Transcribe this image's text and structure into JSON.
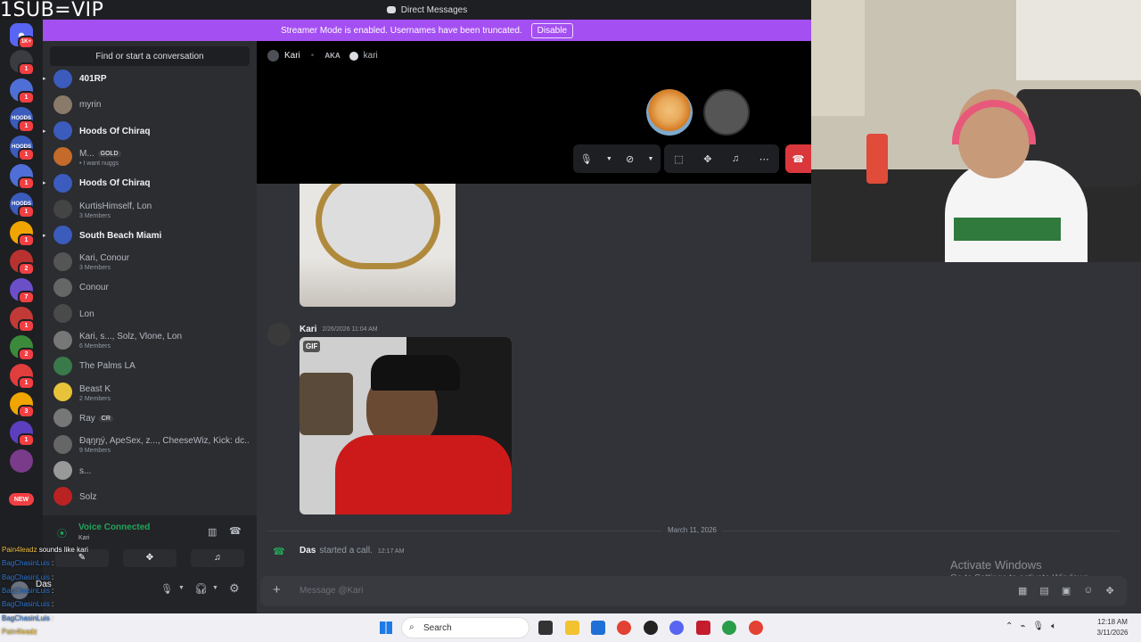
{
  "overlay": {
    "title": "1SUB=VIP"
  },
  "window": {
    "title": "Direct Messages"
  },
  "banner": {
    "text": "Streamer Mode is enabled. Usernames have been truncated.",
    "button": "Disable"
  },
  "rail": {
    "top_badge": "1K+",
    "servers": [
      {
        "label": "",
        "badge": "1",
        "color": "#3a3c42"
      },
      {
        "label": "",
        "badge": "1",
        "color": "#4f6fd6"
      },
      {
        "label": "HOODS",
        "badge": "1",
        "color": "#3b5bbd"
      },
      {
        "label": "HOODS",
        "badge": "1",
        "color": "#3b5bbd"
      },
      {
        "label": "",
        "badge": "1",
        "color": "#4f6fd6"
      },
      {
        "label": "HOODS",
        "badge": "1",
        "color": "#3b5bbd"
      },
      {
        "label": "",
        "badge": "1",
        "color": "#f0a500"
      },
      {
        "label": "",
        "badge": "2",
        "color": "#b8322f"
      },
      {
        "label": "",
        "badge": "7",
        "color": "#6b4fc9"
      },
      {
        "label": "",
        "badge": "1",
        "color": "#c23a36"
      },
      {
        "label": "",
        "badge": "2",
        "color": "#3a8a3a"
      },
      {
        "label": "",
        "badge": "1",
        "color": "#e03d3d"
      },
      {
        "label": "",
        "badge": "3",
        "color": "#f0a500"
      },
      {
        "label": "",
        "badge": "1",
        "color": "#5b3fbf"
      },
      {
        "label": "",
        "badge": "",
        "color": "#7a3b8a"
      }
    ],
    "new_label": "NEW"
  },
  "sidebar": {
    "search_placeholder": "Find or start a conversation",
    "dms": [
      {
        "name": "401RP",
        "sub": "",
        "bold": true,
        "arrow": true,
        "tag": ""
      },
      {
        "name": "myrin",
        "sub": "",
        "bold": false,
        "arrow": false,
        "tag": ""
      },
      {
        "name": "Hoods Of Chiraq",
        "sub": "",
        "bold": true,
        "arrow": true,
        "tag": ""
      },
      {
        "name": "M...",
        "sub": "• I want nuggs",
        "bold": false,
        "arrow": false,
        "tag": "GOLD"
      },
      {
        "name": "Hoods Of Chiraq",
        "sub": "",
        "bold": true,
        "arrow": true,
        "tag": ""
      },
      {
        "name": "KurtisHimself, Lon",
        "sub": "3 Members",
        "bold": false,
        "arrow": false,
        "tag": ""
      },
      {
        "name": "South Beach Miami",
        "sub": "",
        "bold": true,
        "arrow": true,
        "tag": ""
      },
      {
        "name": "Kari, Conour",
        "sub": "3 Members",
        "bold": false,
        "arrow": false,
        "tag": ""
      },
      {
        "name": "Conour",
        "sub": "",
        "bold": false,
        "arrow": false,
        "tag": ""
      },
      {
        "name": "Lon",
        "sub": "",
        "bold": false,
        "arrow": false,
        "tag": ""
      },
      {
        "name": "Kari, s..., Solz, Vlone, Lon",
        "sub": "6 Members",
        "bold": false,
        "arrow": false,
        "tag": ""
      },
      {
        "name": "The Palms LA",
        "sub": "",
        "bold": false,
        "arrow": false,
        "tag": ""
      },
      {
        "name": "Beast K",
        "sub": "2 Members",
        "bold": false,
        "arrow": false,
        "tag": ""
      },
      {
        "name": "Ray",
        "sub": "",
        "bold": false,
        "arrow": false,
        "tag": "CR"
      },
      {
        "name": "Đąŋŋý, ApeSex, z..., CheeseWiz, Kick: dc...",
        "sub": "9 Members",
        "bold": false,
        "arrow": false,
        "tag": ""
      },
      {
        "name": "s...",
        "sub": "",
        "bold": false,
        "arrow": false,
        "tag": ""
      },
      {
        "name": "Solz",
        "sub": "",
        "bold": false,
        "arrow": false,
        "tag": ""
      }
    ],
    "voice": {
      "status": "Voice Connected",
      "channel": "Kari",
      "user": "Das"
    }
  },
  "chat_overlay": {
    "lines": [
      {
        "user": "Pain4leadz",
        "text": "sounds like kari"
      },
      {
        "user": "BagChasinLuis",
        "text": ":"
      },
      {
        "user": "BagChasinLuis",
        "text": ":"
      },
      {
        "user": "BagChasinLuis",
        "text": ":"
      },
      {
        "user": "BagChasinLuis",
        "text": ":"
      },
      {
        "user": "BagChasinLuis",
        "text": ":"
      },
      {
        "user": "Pain4leadz",
        "text": ""
      }
    ]
  },
  "call_header": {
    "name": "Kari",
    "aka": "AKA",
    "aka_name": "kari"
  },
  "messages": {
    "author": "Kari",
    "timestamp": "2/26/2026 11:04 AM",
    "gif_label": "GIF",
    "date_divider": "March 11, 2026",
    "call_user": "Das",
    "call_text": "started a call.",
    "call_time": "12:17 AM"
  },
  "composer": {
    "placeholder": "Message @Kari"
  },
  "watermark": {
    "title": "Activate Windows",
    "subtitle": "Go to Settings to activate Windows."
  },
  "taskbar": {
    "search": "Search",
    "time": "12:18 AM",
    "date": "3/11/2026"
  },
  "colors": {
    "accent": "#a44ff2",
    "hangup": "#da373c",
    "online": "#23a55a"
  }
}
